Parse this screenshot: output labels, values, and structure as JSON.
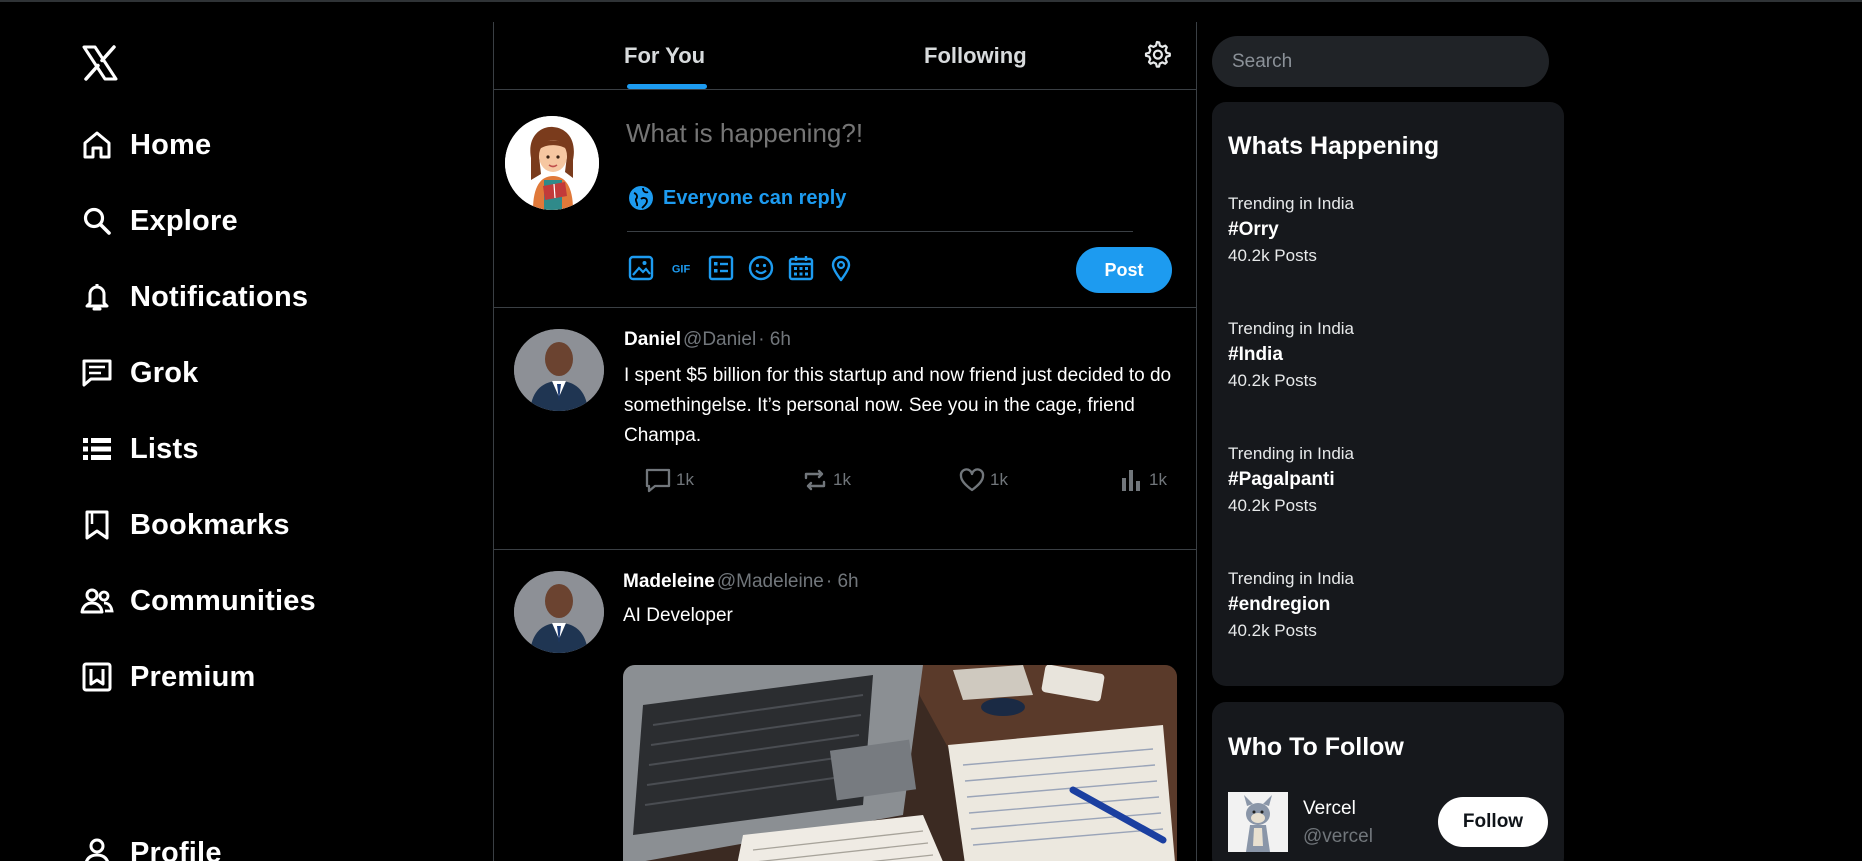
{
  "sidebar": {
    "logo": "x-logo-icon",
    "items": [
      {
        "label": "Home",
        "icon": "home-icon"
      },
      {
        "label": "Explore",
        "icon": "search-icon"
      },
      {
        "label": "Notifications",
        "icon": "bell-icon"
      },
      {
        "label": "Grok",
        "icon": "message-icon"
      },
      {
        "label": "Lists",
        "icon": "list-icon"
      },
      {
        "label": "Bookmarks",
        "icon": "bookmark-icon"
      },
      {
        "label": "Communities",
        "icon": "people-icon"
      },
      {
        "label": "Premium",
        "icon": "premium-icon"
      },
      {
        "label": "Profile",
        "icon": "person-icon"
      }
    ]
  },
  "tabs": {
    "for_you": "For You",
    "following": "Following",
    "active": "For You"
  },
  "composer": {
    "placeholder": "What is happening?!",
    "reply_setting": "Everyone can reply",
    "tools": [
      "image-icon",
      "gif-icon",
      "poll-icon",
      "emoji-icon",
      "schedule-icon",
      "location-icon"
    ],
    "post_label": "Post"
  },
  "tweets": [
    {
      "name": "Daniel",
      "handle": "@Daniel",
      "time": " · 6h",
      "text": "I spent $5 billion for this startup and now friend just decided to do somethingelse. It’s personal now. See you in the cage, friend Champa.",
      "replies": "1k",
      "reposts": "1k",
      "likes": "1k",
      "views": "1k"
    },
    {
      "name": "Madeleine",
      "handle": " @Madeleine",
      "time": " · 6h",
      "text": "AI Developer"
    }
  ],
  "search": {
    "placeholder": "Search"
  },
  "trends": {
    "title": "Whats Happening",
    "items": [
      {
        "context": "Trending in India",
        "tag": "#Orry",
        "count": "40.2k Posts"
      },
      {
        "context": "Trending in India",
        "tag": "#India",
        "count": "40.2k Posts"
      },
      {
        "context": "Trending in India",
        "tag": "#Pagalpanti",
        "count": "40.2k Posts"
      },
      {
        "context": "Trending in India",
        "tag": "#endregion",
        "count": "40.2k Posts"
      }
    ]
  },
  "who_to_follow": {
    "title": "Who To Follow",
    "items": [
      {
        "name": "Vercel",
        "handle": "@vercel",
        "button": "Follow"
      }
    ]
  },
  "colors": {
    "accent": "#1d9bf0",
    "background": "#000000",
    "panel": "#16181c",
    "border": "#3a3f44",
    "muted": "#71767b"
  }
}
